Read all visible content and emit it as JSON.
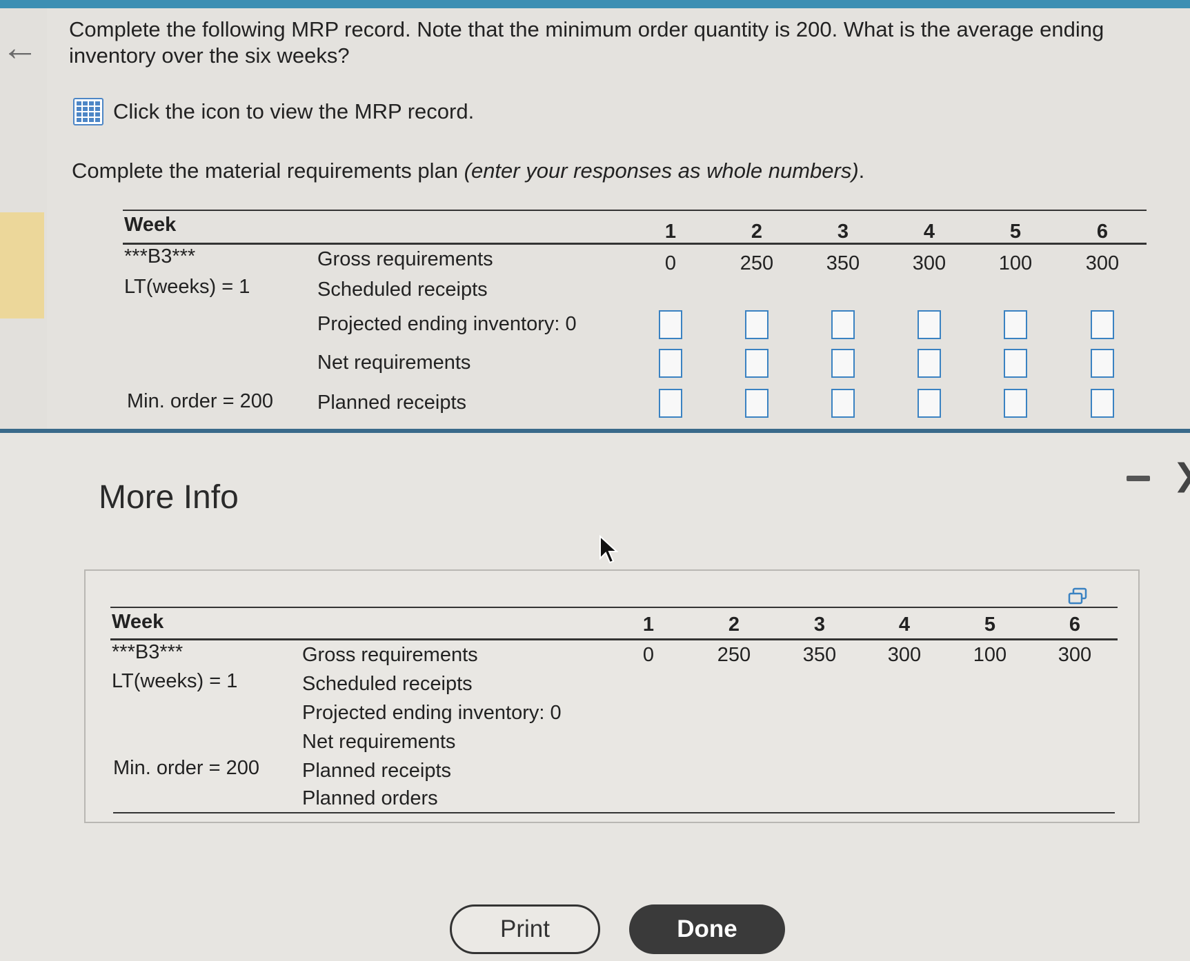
{
  "question": {
    "text": "Complete the following MRP record. Note that the minimum order quantity is 200. What is the average ending inventory over the six weeks?",
    "icon_link": "Click the icon to view the MRP record.",
    "instruction_main": "Complete the material requirements plan ",
    "instruction_italic": "(enter your responses as whole numbers)",
    "instruction_end": "."
  },
  "mrp": {
    "week_label": "Week",
    "item": "***B3***",
    "lead_time": "LT(weeks) = 1",
    "min_order": "Min. order = 200",
    "weeks": [
      "1",
      "2",
      "3",
      "4",
      "5",
      "6"
    ],
    "rows": {
      "gross": "Gross requirements",
      "scheduled": "Scheduled receipts",
      "projected": "Projected ending inventory: 0",
      "net": "Net requirements",
      "planned_receipts": "Planned receipts",
      "planned_orders": "Planned orders"
    },
    "gross_values": [
      "0",
      "250",
      "350",
      "300",
      "100",
      "300"
    ]
  },
  "modal": {
    "title": "More Info",
    "minimize_icon": "minimize-icon",
    "close_icon": "close-icon",
    "copy_icon": "copy-icon",
    "print_label": "Print",
    "done_label": "Done"
  },
  "colors": {
    "accent": "#3d8fb3",
    "input_border": "#3a82c2",
    "done_bg": "#3a3a3a"
  }
}
